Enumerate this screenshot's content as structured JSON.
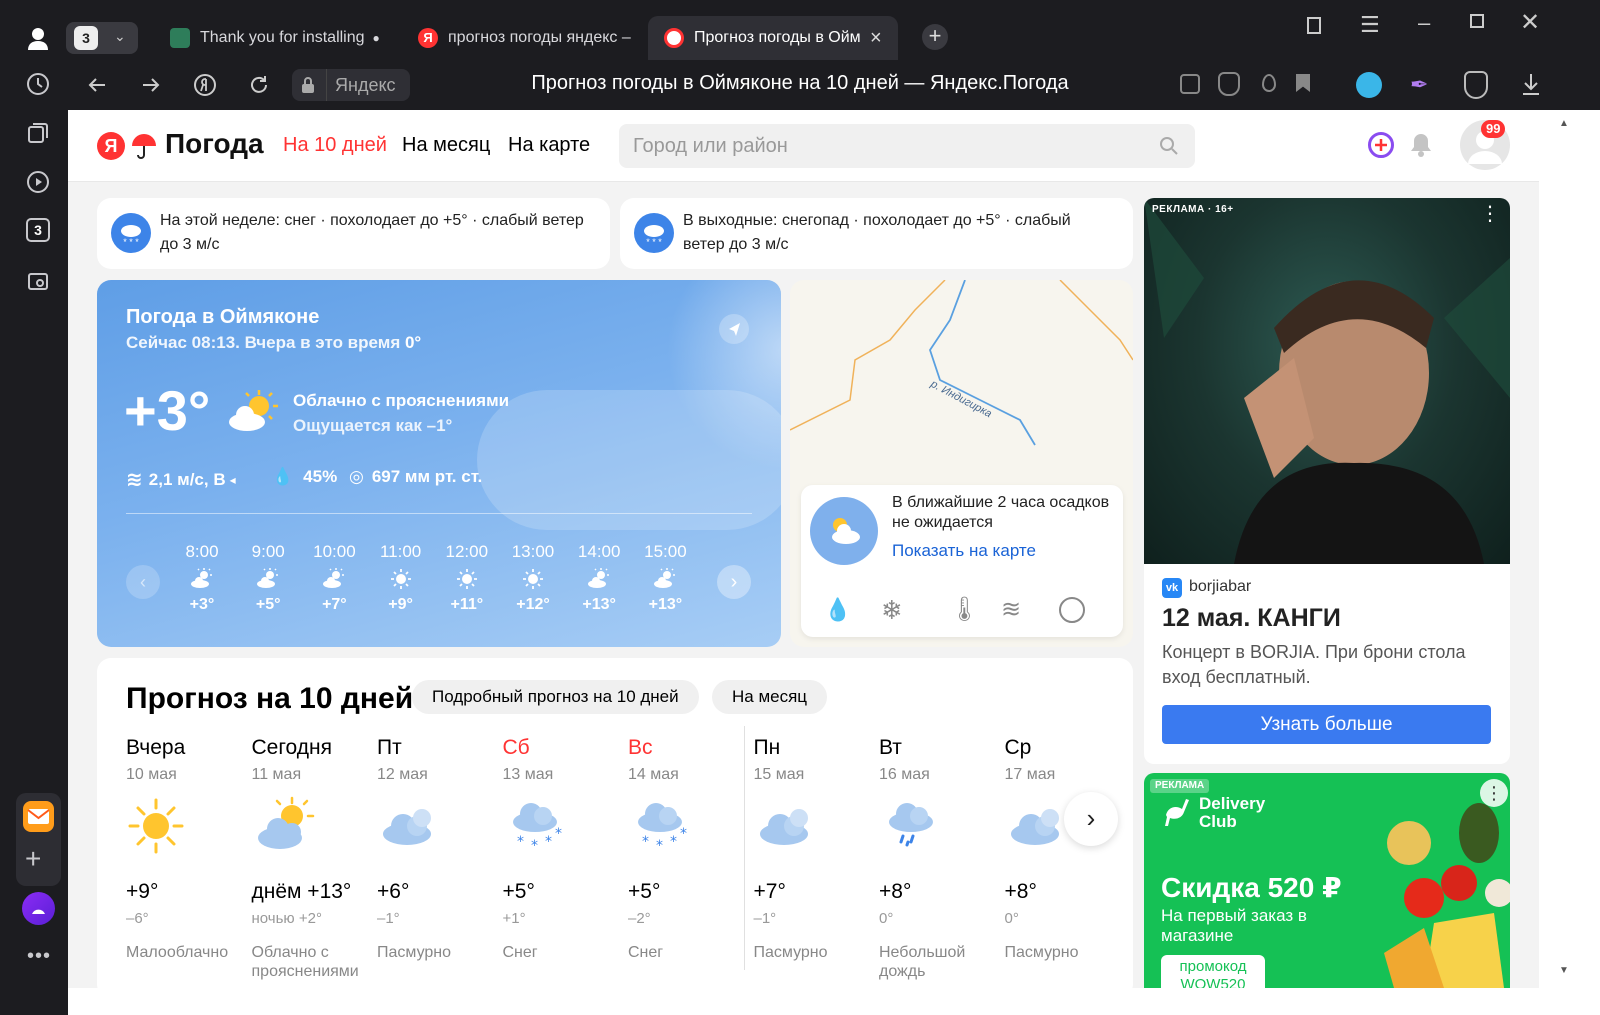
{
  "browser": {
    "tab_count": "3",
    "tabs": [
      {
        "title": "Thank you for installing",
        "dot": "●"
      },
      {
        "title": "прогноз погоды яндекс –"
      },
      {
        "title": "Прогноз погоды в Оймяконе на 10 дней — Яндекс.Погода",
        "short": "Прогноз погоды в Ойм",
        "close": "×"
      }
    ],
    "new_tab": "+",
    "domain": "Яндекс",
    "page_title": "Прогноз погоды в Оймяконе на 10 дней — Яндекс.Погода",
    "sidebar_counter": "3"
  },
  "site": {
    "logo_letter": "Я",
    "logo_text": "Погода",
    "nav": [
      "На 10 дней",
      "На месяц",
      "На карте"
    ],
    "search_placeholder": "Город или район",
    "notif_count": "99"
  },
  "alerts": [
    {
      "text": "На этой неделе: снег · похолодает до +5° · слабый ветер до 3 м/с"
    },
    {
      "text": "В выходные: снегопад · похолодает до +5° · слабый ветер до 3 м/с"
    }
  ],
  "current": {
    "title": "Погода в Оймяконе",
    "subtitle": "Сейчас 08:13. Вчера в это время",
    "yesterday_temp": "0°",
    "temp": "+3°",
    "condition": "Облачно с прояснениями",
    "feels_like": "Ощущается как –1°",
    "wind": "2,1 м/с, В",
    "humidity": "45%",
    "pressure": "697 мм рт. ст.",
    "hours": [
      {
        "time": "8:00",
        "temp": "+3°",
        "icon": "partly-cloudy"
      },
      {
        "time": "9:00",
        "temp": "+5°",
        "icon": "partly-cloudy"
      },
      {
        "time": "10:00",
        "temp": "+7°",
        "icon": "partly-cloudy"
      },
      {
        "time": "11:00",
        "temp": "+9°",
        "icon": "sun"
      },
      {
        "time": "12:00",
        "temp": "+11°",
        "icon": "sun"
      },
      {
        "time": "13:00",
        "temp": "+12°",
        "icon": "sun"
      },
      {
        "time": "14:00",
        "temp": "+13°",
        "icon": "partly-cloudy"
      },
      {
        "time": "15:00",
        "temp": "+13°",
        "icon": "partly-cloudy"
      }
    ]
  },
  "map": {
    "river_label": "р. Индигирка",
    "nowcast": "В ближайшие 2 часа осадков не ожидается",
    "show_link": "Показать на карте"
  },
  "forecast": {
    "title": "Прогноз на 10 дней",
    "pill_detail": "Подробный прогноз на 10 дней",
    "pill_month": "На месяц",
    "days": [
      {
        "name": "Вчера",
        "date": "10 мая",
        "day_temp": "+9°",
        "night_temp": "–6°",
        "condition": "Малооблачно",
        "icon": "sun",
        "weekend": false
      },
      {
        "name": "Сегодня",
        "date": "11 мая",
        "day_temp": "днём +13°",
        "night_temp": "ночью +2°",
        "condition": "Облачно с прояснениями",
        "icon": "partly-cloudy",
        "weekend": false
      },
      {
        "name": "Пт",
        "date": "12 мая",
        "day_temp": "+6°",
        "night_temp": "–1°",
        "condition": "Пасмурно",
        "icon": "cloud",
        "weekend": false
      },
      {
        "name": "Сб",
        "date": "13 мая",
        "day_temp": "+5°",
        "night_temp": "+1°",
        "condition": "Снег",
        "icon": "snow",
        "weekend": true
      },
      {
        "name": "Вс",
        "date": "14 мая",
        "day_temp": "+5°",
        "night_temp": "–2°",
        "condition": "Снег",
        "icon": "snow",
        "weekend": true
      },
      {
        "name": "Пн",
        "date": "15 мая",
        "day_temp": "+7°",
        "night_temp": "–1°",
        "condition": "Пасмурно",
        "icon": "cloud",
        "weekend": false
      },
      {
        "name": "Вт",
        "date": "16 мая",
        "day_temp": "+8°",
        "night_temp": "0°",
        "condition": "Небольшой дождь",
        "icon": "rain",
        "weekend": false
      },
      {
        "name": "Ср",
        "date": "17 мая",
        "day_temp": "+8°",
        "night_temp": "0°",
        "condition": "Пасмурно",
        "icon": "cloud",
        "weekend": false
      }
    ]
  },
  "ads": {
    "ad1": {
      "label": "РЕКЛАМА · 16+",
      "source": "borjiabar",
      "title": "12 мая. КАНГИ",
      "text": "Концерт в BORJIA. При брони стола вход бесплатный.",
      "button": "Узнать больше"
    },
    "ad2": {
      "label": "РЕКЛАМА",
      "brand": "Delivery Club",
      "headline": "Скидка 520 ₽",
      "sub": "На первый заказ в магазине",
      "promo": "промокод WOW520"
    }
  },
  "colors": {
    "accent_red": "#f33",
    "link_blue": "#1a63d6",
    "button_blue": "#3a7af0",
    "delivery_green": "#15c155"
  }
}
